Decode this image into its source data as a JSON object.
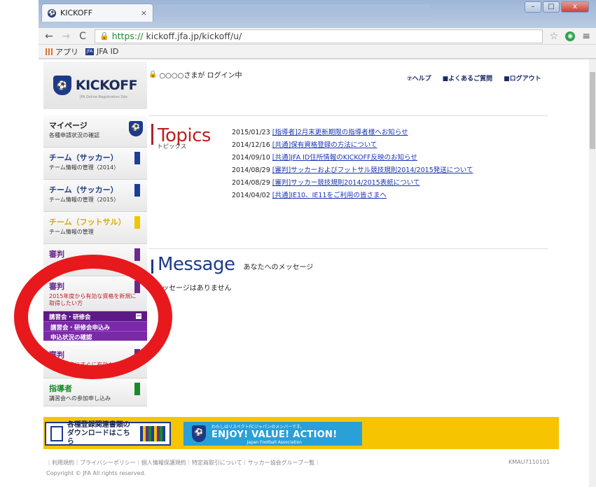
{
  "browser": {
    "tab_title": "KICKOFF",
    "tab_close": "×",
    "url_https": "https://",
    "url_rest": "kickoff.jfa.jp/kickoff/u/",
    "back": "←",
    "forward": "→",
    "reload": "C",
    "bookmarks": [
      {
        "label": "アプリ"
      },
      {
        "label": "JFA ID"
      }
    ],
    "jfa_badge": "JFA",
    "window_buttons": {
      "min": "–",
      "max": "□",
      "close": "x"
    }
  },
  "header": {
    "logo_text": "KICKOFF",
    "logo_sub": "JFA Online Registration Site",
    "login_status": "○○○○さまが ログイン中",
    "links": [
      {
        "label": "⑦ヘルプ"
      },
      {
        "label": "■よくあるご質問"
      },
      {
        "label": "■ログアウト"
      }
    ]
  },
  "sidebar": {
    "items": [
      {
        "title": "マイページ",
        "desc": "各種申請状況の確認",
        "color": "#222222"
      },
      {
        "title": "チーム（サッカー）",
        "desc": "チーム情報の管理（2014）",
        "color": "#1d3a8a"
      },
      {
        "title": "チーム（サッカー）",
        "desc": "チーム情報の管理（2015）",
        "color": "#1d3a8a"
      },
      {
        "title": "チーム（フットサル）",
        "desc": "チーム情報の管理",
        "color": "#e0a800"
      },
      {
        "title": "審判",
        "desc": "",
        "color": "#6a2a8c"
      },
      {
        "title": "審判",
        "desc": "2015年度から有効な資格を新規に取得したい方",
        "color": "#6a2a8c"
      },
      {
        "title": "審判",
        "desc": "2014年度にすぐに有効な",
        "color": "#6a2a8c"
      },
      {
        "title": "指導者",
        "desc": "講習会への参加申し込み",
        "color": "#1a8a2a"
      }
    ],
    "submenu": {
      "header": "講習会・研修会",
      "min": "－",
      "links": [
        {
          "label": "講習会・研修会申込み"
        },
        {
          "label": "申込状況の確認"
        }
      ]
    }
  },
  "topics": {
    "title": "Topics",
    "subtitle": "トピックス",
    "items": [
      {
        "date": "2015/01/23",
        "text": "[指導者]2月末更新期限の指導者様へお知らせ"
      },
      {
        "date": "2014/12/16",
        "text": "[共通]保有資格登録の方法について"
      },
      {
        "date": "2014/09/10",
        "text": "[共通]JFA ID住所情報のKICKOFF反映のお知らせ"
      },
      {
        "date": "2014/08/29",
        "text": "[審判]サッカーおよびフットサル競技規則2014/2015発送について"
      },
      {
        "date": "2014/08/29",
        "text": "[審判]サッカー競技規則2014/2015表紙について"
      },
      {
        "date": "2014/04/02",
        "text": "[共通]IE10、IE11をご利用の皆さまへ"
      }
    ]
  },
  "message": {
    "title": "Message",
    "subtitle": "あなたへのメッセージ",
    "empty": "メッセージはありません"
  },
  "banners": {
    "download_line1": "各種登録関連書類の",
    "download_line2": "ダウンロードはこちら",
    "enjoy_small": "わたしはリスペクトFCジャパンのメンバーです。",
    "enjoy_big": "ENJOY! VALUE! ACTION!",
    "enjoy_sub": "Japan Football Association"
  },
  "footer": {
    "links": "｜利用規約｜プライバシーポリシー｜個人情報保護規約｜特定商取引について｜サッカー協会グループ一覧｜",
    "copyright": "Copyright © JFA All rights reserved.",
    "page_code": "KMAU7110101"
  },
  "colors": {
    "annotation_circle": "#e8191c",
    "brand_navy": "#1d3a8a",
    "link": "#1a33b8",
    "banner_yellow": "#f6c400"
  }
}
